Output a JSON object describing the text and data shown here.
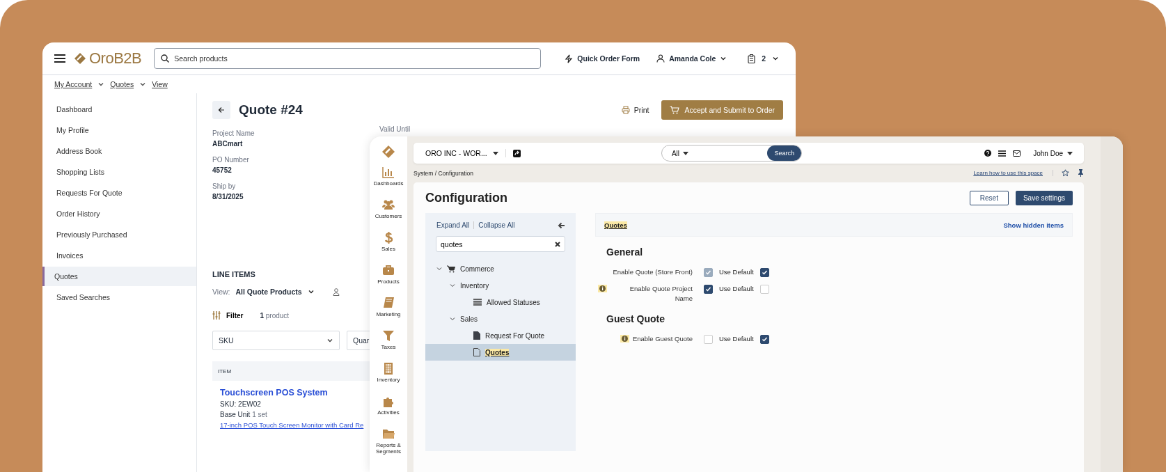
{
  "storefront": {
    "logo": "OroB2B",
    "search": {
      "placeholder": "Search products"
    },
    "quick_order": "Quick Order Form",
    "user": "Amanda Cole",
    "cart_count": "2",
    "breadcrumb": [
      "My Account",
      "Quotes",
      "View"
    ],
    "sidebar": {
      "items": [
        {
          "label": "Dashboard",
          "selected": false
        },
        {
          "label": "My Profile",
          "selected": false
        },
        {
          "label": "Address Book",
          "selected": false
        },
        {
          "label": "Shopping Lists",
          "selected": false
        },
        {
          "label": "Requests For Quote",
          "selected": false
        },
        {
          "label": "Order History",
          "selected": false
        },
        {
          "label": "Previously Purchased",
          "selected": false
        },
        {
          "label": "Invoices",
          "selected": false
        },
        {
          "label": "Quotes",
          "selected": true
        },
        {
          "label": "Saved Searches",
          "selected": false
        }
      ]
    },
    "quote": {
      "title": "Quote #24",
      "print": "Print",
      "submit": "Accept and Submit to Order",
      "valid_until_label": "Valid Until",
      "fields": [
        {
          "label": "Project Name",
          "value": "ABCmart"
        },
        {
          "label": "PO Number",
          "value": "45752"
        },
        {
          "label": "Ship by",
          "value": "8/31/2025"
        }
      ]
    },
    "line_items": {
      "title": "LINE ITEMS",
      "view_label": "View:",
      "view_value": "All Quote Products",
      "filter": "Filter",
      "count": "**1** product",
      "sku_select": "SKU",
      "quantity_select": "Quar",
      "columns": [
        "ITEM"
      ],
      "item": {
        "name": "Touchscreen POS System",
        "sku": "SKU: 2EW02",
        "unit_label": "Base Unit",
        "unit_value": "1 set",
        "description": "17-inch POS Touch Screen Monitor with Card Re"
      }
    }
  },
  "admin": {
    "nav": {
      "items": [
        {
          "label": "Dashboards",
          "kind": "chart"
        },
        {
          "label": "Customers",
          "kind": "people"
        },
        {
          "label": "Sales",
          "kind": "money"
        },
        {
          "label": "Products",
          "kind": "briefcase"
        },
        {
          "label": "Marketing",
          "kind": "book"
        },
        {
          "label": "Taxes",
          "kind": "funnel"
        },
        {
          "label": "Inventory",
          "kind": "building"
        },
        {
          "label": "Activities",
          "kind": "puzzle"
        },
        {
          "label": "Reports & Segments",
          "kind": "folder"
        }
      ]
    },
    "organization": "ORO INC - WOR...",
    "search": {
      "scope": "All",
      "button": "Search"
    },
    "user": "John Doe",
    "breadcrumb": "System / Configuration",
    "help_link": "Learn how to use this space",
    "config": {
      "title": "Configuration",
      "reset": "Reset",
      "save": "Save settings",
      "expand_all": "Expand All",
      "collapse_all": "Collapse All",
      "tree_search": "quotes",
      "tree": [
        {
          "label": "Commerce",
          "kind": "section",
          "expanded": true,
          "selected": false,
          "match": false,
          "children": [
            {
              "label": "Inventory",
              "expanded": true,
              "selected": false,
              "match": false,
              "children": [
                {
                  "label": "Allowed Statuses",
                  "kind": "list",
                  "selected": false,
                  "match": false
                }
              ]
            },
            {
              "label": "Sales",
              "expanded": true,
              "selected": false,
              "match": false,
              "children": [
                {
                  "label": "Request For Quote",
                  "kind": "page",
                  "selected": false,
                  "match": false
                },
                {
                  "label": "Quotes",
                  "kind": "page",
                  "selected": true,
                  "match": true
                }
              ]
            }
          ]
        }
      ],
      "section": {
        "title": "Quotes",
        "match": true,
        "show_hidden": "Show hidden items",
        "groups": [
          {
            "title": "General",
            "fields": [
              {
                "label": "Enable Quote (Store Front)",
                "info": false,
                "checked": true,
                "disabled": true,
                "use_default_label": "Use Default",
                "use_default": true
              },
              {
                "label": "Enable Quote Project Name",
                "info": true,
                "checked": true,
                "disabled": false,
                "use_default_label": "Use Default",
                "use_default": false
              }
            ]
          },
          {
            "title": "Guest Quote",
            "fields": [
              {
                "label": "Enable Guest Quote",
                "info": true,
                "checked": false,
                "disabled": false,
                "use_default_label": "Use Default",
                "use_default": true
              }
            ]
          }
        ]
      }
    }
  }
}
